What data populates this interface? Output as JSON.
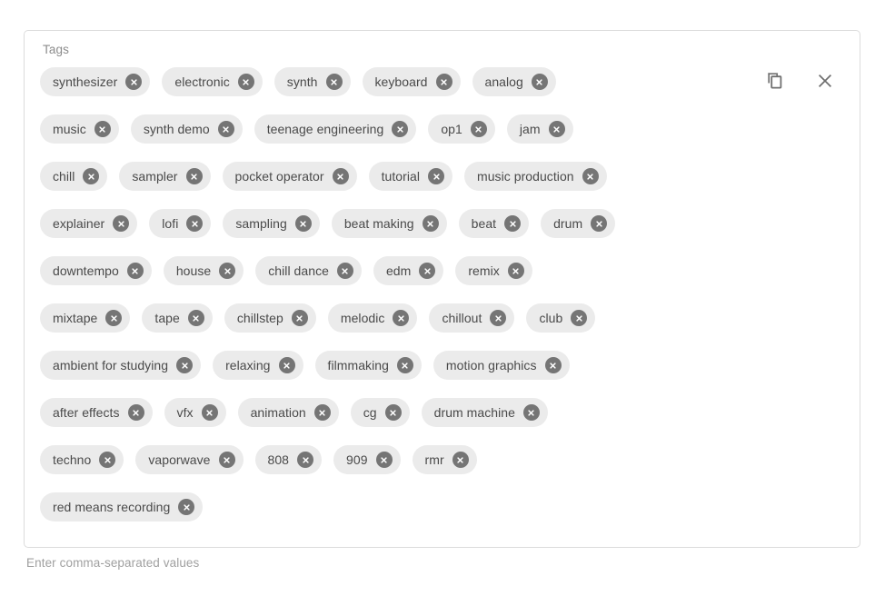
{
  "field": {
    "label": "Tags",
    "hint": "Enter comma-separated values",
    "chip_bg_color": "#ebebeb",
    "chip_text_color": "#4a4a4a",
    "remove_badge_color": "#757575",
    "border_color": "#dcdcdc",
    "label_color": "#8c8c8c",
    "hint_color": "#a0a0a0"
  },
  "actions": [
    {
      "name": "copy-button",
      "icon": "copy-icon",
      "label": "Copy"
    },
    {
      "name": "clear-button",
      "icon": "close-icon",
      "label": "Clear"
    }
  ],
  "tag_rows": [
    [
      "synthesizer",
      "electronic",
      "synth",
      "keyboard",
      "analog"
    ],
    [
      "music",
      "synth demo",
      "teenage engineering",
      "op1",
      "jam"
    ],
    [
      "chill",
      "sampler",
      "pocket operator",
      "tutorial",
      "music production"
    ],
    [
      "explainer",
      "lofi",
      "sampling",
      "beat making",
      "beat",
      "drum"
    ],
    [
      "downtempo",
      "house",
      "chill dance",
      "edm",
      "remix"
    ],
    [
      "mixtape",
      "tape",
      "chillstep",
      "melodic",
      "chillout",
      "club"
    ],
    [
      "ambient for studying",
      "relaxing",
      "filmmaking",
      "motion graphics"
    ],
    [
      "after effects",
      "vfx",
      "animation",
      "cg",
      "drum machine"
    ],
    [
      "techno",
      "vaporwave",
      "808",
      "909",
      "rmr"
    ],
    [
      "red means recording"
    ]
  ],
  "tags": [
    "synthesizer",
    "electronic",
    "synth",
    "keyboard",
    "analog",
    "music",
    "synth demo",
    "teenage engineering",
    "op1",
    "jam",
    "chill",
    "sampler",
    "pocket operator",
    "tutorial",
    "music production",
    "explainer",
    "lofi",
    "sampling",
    "beat making",
    "beat",
    "drum",
    "downtempo",
    "house",
    "chill dance",
    "edm",
    "remix",
    "mixtape",
    "tape",
    "chillstep",
    "melodic",
    "chillout",
    "club",
    "ambient for studying",
    "relaxing",
    "filmmaking",
    "motion graphics",
    "after effects",
    "vfx",
    "animation",
    "cg",
    "drum machine",
    "techno",
    "vaporwave",
    "808",
    "909",
    "rmr",
    "red means recording"
  ],
  "tag_count": 47
}
